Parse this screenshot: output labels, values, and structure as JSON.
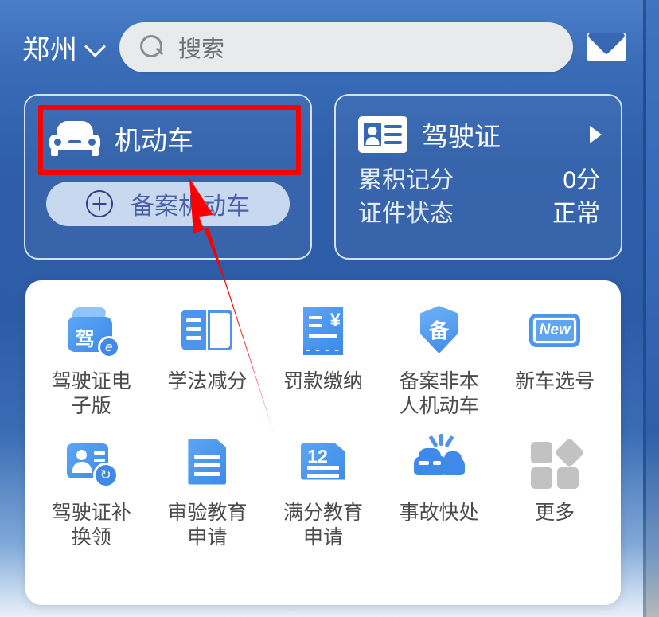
{
  "header": {
    "city": "郑州",
    "city_chevron_icon": "chevron-down-icon",
    "search_placeholder": "搜索",
    "search_icon": "search-icon",
    "mail_icon": "mail-icon"
  },
  "vehicle_card": {
    "icon": "car-icon",
    "title": "机动车",
    "record_button": {
      "icon": "plus-circle-icon",
      "label": "备案机动车"
    }
  },
  "license_card": {
    "icon": "id-card-icon",
    "title": "驾驶证",
    "chevron_icon": "chevron-right-icon",
    "rows": [
      {
        "key": "累积记分",
        "value": "0分"
      },
      {
        "key": "证件状态",
        "value": "正常"
      }
    ]
  },
  "grid": [
    {
      "icon": "license-ebook-icon",
      "icon_text": "驾",
      "badge": "e",
      "label": "驾驶证电子版"
    },
    {
      "icon": "open-book-icon",
      "icon_text": "",
      "badge": "",
      "label": "学法减分"
    },
    {
      "icon": "receipt-yen-icon",
      "icon_text": "¥",
      "badge": "",
      "label": "罚款缴纳"
    },
    {
      "icon": "shield-record-icon",
      "icon_text": "备",
      "badge": "",
      "label": "备案非本人机动车"
    },
    {
      "icon": "license-plate-new-icon",
      "icon_text": "New",
      "badge": "",
      "label": "新车选号"
    },
    {
      "icon": "id-swap-icon",
      "icon_text": "",
      "badge": "↻",
      "label": "驾驶证补换领"
    },
    {
      "icon": "document-lines-icon",
      "icon_text": "",
      "badge": "",
      "label": "审验教育申请"
    },
    {
      "icon": "document-12-icon",
      "icon_text": "12",
      "badge": "",
      "label": "满分教育申请"
    },
    {
      "icon": "car-crash-icon",
      "icon_text": "",
      "badge": "",
      "label": "事故快处"
    },
    {
      "icon": "more-grid-icon",
      "icon_text": "",
      "badge": "",
      "label": "更多"
    }
  ],
  "annotation": {
    "highlight_color": "#fc0000",
    "highlight_target": "机动车",
    "arrow_icon": "pointer-arrow-icon"
  }
}
